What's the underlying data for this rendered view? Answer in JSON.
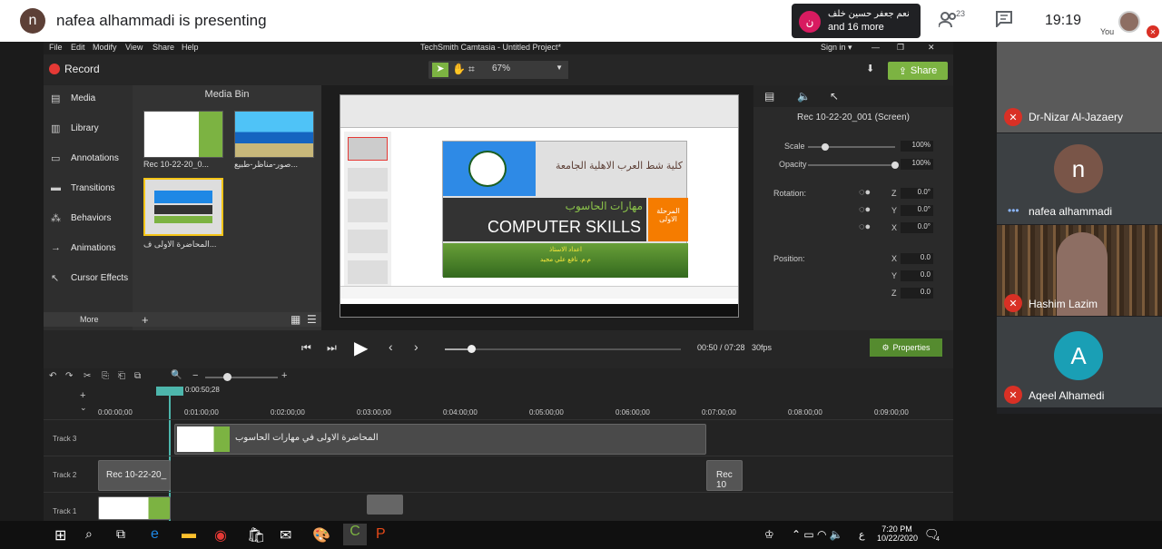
{
  "meet": {
    "presenter_initial": "n",
    "presenting_text": "nafea alhammadi is presenting",
    "toast_initial": "ن",
    "toast_line1": "نعم جعفر حسين خلف",
    "toast_line2": "and 16 more",
    "people_count": "23",
    "clock": "19:19",
    "you_label": "You",
    "participants": [
      {
        "name": "Dr-Nizar Al-Jazaery"
      },
      {
        "name": "nafea alhammadi",
        "initial": "n"
      },
      {
        "name": "Hashim Lazim"
      },
      {
        "name": "Aqeel Alhamedi",
        "initial": "A"
      }
    ],
    "colors": {
      "presenter_avatar": "#5d4037",
      "mic_off": "#d93025",
      "toast_avatar": "#d81b60",
      "aqeel_avatar": "#1a9fb5",
      "nafea_avatar": "#795548"
    }
  },
  "camtasia": {
    "title": "TechSmith Camtasia - Untitled Project*",
    "menus": [
      "File",
      "Edit",
      "Modify",
      "View",
      "Share",
      "Help"
    ],
    "signin": "Sign in ▾",
    "record": "Record",
    "zoom": "67%",
    "share": "Share",
    "nav": [
      {
        "label": "Media",
        "icon": "film-icon"
      },
      {
        "label": "Library",
        "icon": "library-icon"
      },
      {
        "label": "Annotations",
        "icon": "annotation-icon"
      },
      {
        "label": "Transitions",
        "icon": "transition-icon"
      },
      {
        "label": "Behaviors",
        "icon": "behavior-icon"
      },
      {
        "label": "Animations",
        "icon": "animation-icon"
      },
      {
        "label": "Cursor Effects",
        "icon": "cursor-icon"
      }
    ],
    "more": "More",
    "media_bin": {
      "title": "Media Bin",
      "items": [
        "Rec 10-22-20_0...",
        "صور-مناظر-طبيع...",
        "المحاضرة الاولى ف..."
      ]
    },
    "slide": {
      "university": "كلية شط العرب الاهلية الجامعة",
      "subject_ar": "مهارات الحاسوب",
      "subject_en": "COMPUTER SKILLS",
      "stage": "المرحلة الاولى",
      "prepared_by": "اعداد الاستاذ",
      "teacher": "م.م. نافع علي مجيد"
    },
    "properties": {
      "clip_title": "Rec 10-22-20_001 (Screen)",
      "scale_label": "Scale",
      "scale_value": "100%",
      "opacity_label": "Opacity",
      "opacity_value": "100%",
      "rotation_label": "Rotation:",
      "rot_z": "0.0°",
      "rot_y": "0.0°",
      "rot_x": "0.0°",
      "position_label": "Position:",
      "pos_x": "0.0",
      "pos_y": "0.0",
      "pos_z": "0.0",
      "axis_z": "Z",
      "axis_y": "Y",
      "axis_x": "X",
      "scale_level": 0.2,
      "opacity_level": 1.0
    },
    "playback": {
      "time": "00:50 / 07:28",
      "fps": "30fps",
      "properties_btn": "Properties",
      "progress": 0.11
    },
    "timeline": {
      "playhead": "0:00:50;28",
      "ticks": [
        "0:00:00;00",
        "0:01:00;00",
        "0:02:00;00",
        "0:03:00;00",
        "0:04:00;00",
        "0:05:00;00",
        "0:06:00;00",
        "0:07:00;00",
        "0:08:00;00",
        "0:09:00;00"
      ],
      "tracks": [
        "Track 3",
        "Track 2",
        "Track 1"
      ],
      "clip_track3": "المحاضرة الاولى في مهارات الحاسوب",
      "clip_track2": "Rec 10-22-20_",
      "clip_track2b": "Rec 10"
    }
  },
  "taskbar": {
    "time": "7:20 PM",
    "date": "10/22/2020",
    "lang": "ع",
    "notif": "4"
  }
}
